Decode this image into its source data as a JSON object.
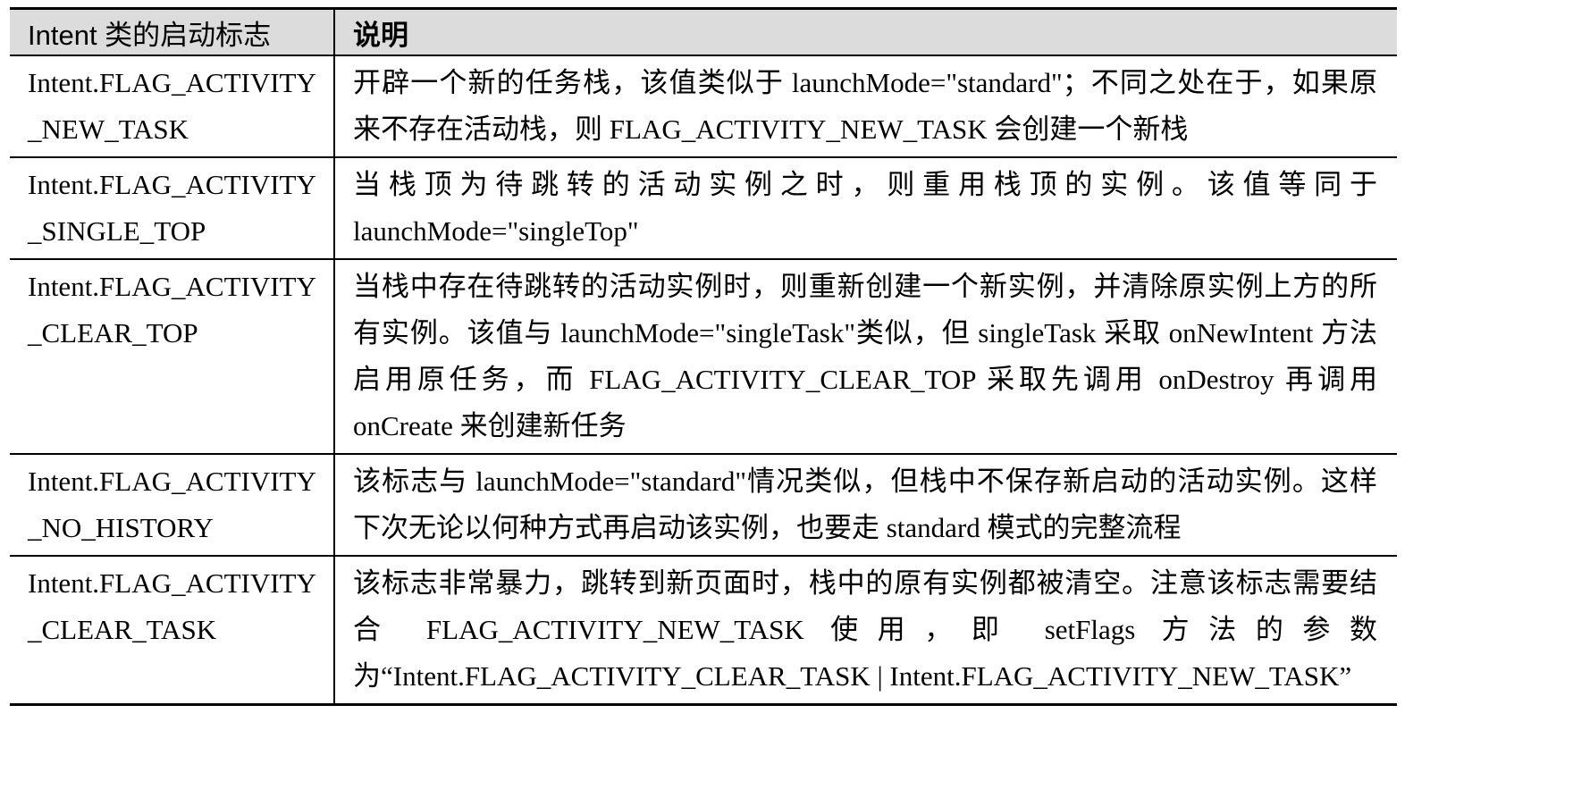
{
  "table": {
    "headers": {
      "flag": "Intent 类的启动标志",
      "description": "说明"
    },
    "rows": [
      {
        "flag": "Intent.FLAG_ACTIVITY_NEW_TASK",
        "description": "开辟一个新的任务栈，该值类似于 launchMode=\"standard\"；不同之处在于，如果原来不存在活动栈，则 FLAG_ACTIVITY_NEW_TASK 会创建一个新栈"
      },
      {
        "flag": "Intent.FLAG_ACTIVITY_SINGLE_TOP",
        "description": "当栈顶为待跳转的活动实例之时，则重用栈顶的实例。该值等同于 launchMode=\"singleTop\""
      },
      {
        "flag": "Intent.FLAG_ACTIVITY_CLEAR_TOP",
        "description": "当栈中存在待跳转的活动实例时，则重新创建一个新实例，并清除原实例上方的所有实例。该值与 launchMode=\"singleTask\"类似，但 singleTask 采取 onNewIntent 方法启用原任务，而 FLAG_ACTIVITY_CLEAR_TOP 采取先调用 onDestroy 再调用 onCreate 来创建新任务"
      },
      {
        "flag": "Intent.FLAG_ACTIVITY_NO_HISTORY",
        "description": "该标志与 launchMode=\"standard\"情况类似，但栈中不保存新启动的活动实例。这样下次无论以何种方式再启动该实例，也要走 standard 模式的完整流程"
      },
      {
        "flag": "Intent.FLAG_ACTIVITY_CLEAR_TASK",
        "description": "该标志非常暴力，跳转到新页面时，栈中的原有实例都被清空。注意该标志需要结合 FLAG_ACTIVITY_NEW_TASK 使用，即 setFlags 方法的参数为“Intent.FLAG_ACTIVITY_CLEAR_TASK | Intent.FLAG_ACTIVITY_NEW_TASK”"
      }
    ]
  }
}
